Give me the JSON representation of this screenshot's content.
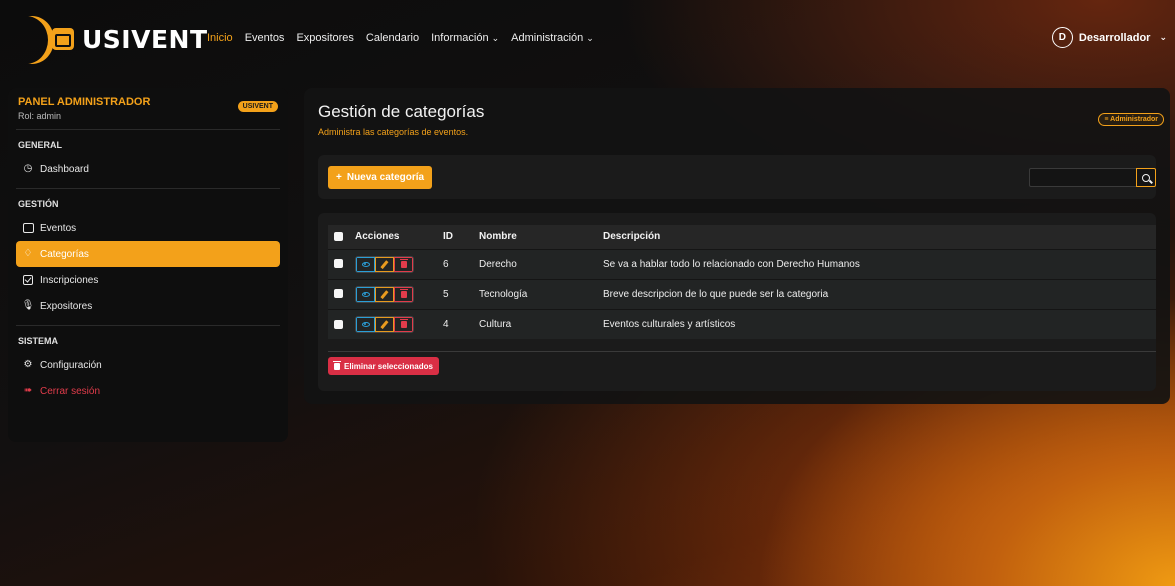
{
  "brand": {
    "name": "USIVENT",
    "accent": "#f3a11a"
  },
  "nav": {
    "links": [
      {
        "label": "Inicio",
        "active": true,
        "dropdown": false
      },
      {
        "label": "Eventos",
        "active": false,
        "dropdown": false
      },
      {
        "label": "Expositores",
        "active": false,
        "dropdown": false
      },
      {
        "label": "Calendario",
        "active": false,
        "dropdown": false
      },
      {
        "label": "Información",
        "active": false,
        "dropdown": true
      },
      {
        "label": "Administración",
        "active": false,
        "dropdown": true
      }
    ],
    "user": {
      "initial": "D",
      "name": "Desarrollador"
    }
  },
  "sidebar": {
    "title": "PANEL ADMINISTRADOR",
    "role": "Rol: admin",
    "badge": "USIVENT",
    "sections": [
      {
        "label": "GENERAL",
        "items": [
          {
            "label": "Dashboard",
            "icon": "dashboard-icon",
            "active": false
          }
        ]
      },
      {
        "label": "GESTIÓN",
        "items": [
          {
            "label": "Eventos",
            "icon": "calendar-icon",
            "active": false
          },
          {
            "label": "Categorías",
            "icon": "tag-icon",
            "active": true
          },
          {
            "label": "Inscripciones",
            "icon": "check-square-icon",
            "active": false
          },
          {
            "label": "Expositores",
            "icon": "microphone-icon",
            "active": false
          }
        ]
      },
      {
        "label": "SISTEMA",
        "items": [
          {
            "label": "Configuración",
            "icon": "gear-icon",
            "active": false
          },
          {
            "label": "Cerrar sesión",
            "icon": "logout-icon",
            "active": false,
            "danger": true
          }
        ]
      }
    ]
  },
  "main": {
    "title": "Gestión de categorías",
    "subtitle": "Administra las categorías de eventos.",
    "admin_pill": "Administrador",
    "new_button": "Nueva categoría",
    "search": {
      "value": "",
      "placeholder": ""
    },
    "table": {
      "columns": [
        "Acciones",
        "ID",
        "Nombre",
        "Descripción"
      ],
      "rows": [
        {
          "id": "6",
          "nombre": "Derecho",
          "descripcion": "Se va a hablar todo lo relacionado con Derecho Humanos"
        },
        {
          "id": "5",
          "nombre": "Tecnología",
          "descripcion": "Breve descripcion de lo que puede ser la categoria"
        },
        {
          "id": "4",
          "nombre": "Cultura",
          "descripcion": "Eventos culturales y artísticos"
        }
      ]
    },
    "delete_selected": "Eliminar seleccionados"
  }
}
